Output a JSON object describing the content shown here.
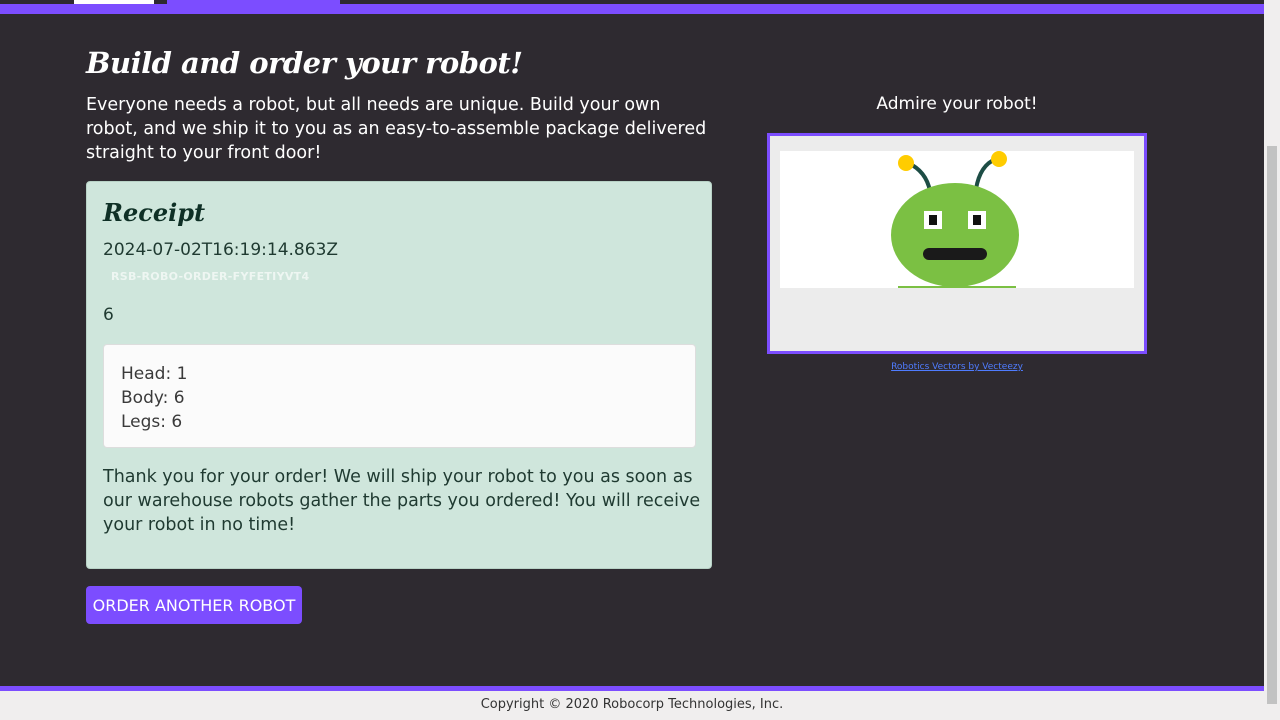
{
  "header": {
    "title": "Build and order your robot!",
    "intro": "Everyone needs a robot, but all needs are unique. Build your own robot, and we ship it to you as an easy-to-assemble package delivered straight to your front door!"
  },
  "receipt": {
    "heading": "Receipt",
    "timestamp": "2024-07-02T16:19:14.863Z",
    "order_id": "RSB-ROBO-ORDER-FYFETIYVT4",
    "order_number": "6",
    "parts": {
      "head": "Head: 1",
      "body": "Body: 6",
      "legs": "Legs: 6"
    },
    "thanks": "Thank you for your order! We will ship your robot to you as soon as our warehouse robots gather the parts you ordered! You will receive your robot in no time!"
  },
  "actions": {
    "order_another_label": "ORDER ANOTHER ROBOT"
  },
  "preview": {
    "heading": "Admire your robot!",
    "credit_link": "Robotics Vectors by Vecteezy"
  },
  "footer": {
    "copyright": "Copyright © 2020 Robocorp Technologies, Inc."
  },
  "colors": {
    "accent": "#7c4dff",
    "background": "#2e2a30",
    "receipt_bg": "#cfe6dc",
    "robot_green": "#7bc043",
    "antenna_yellow": "#ffcc00"
  }
}
